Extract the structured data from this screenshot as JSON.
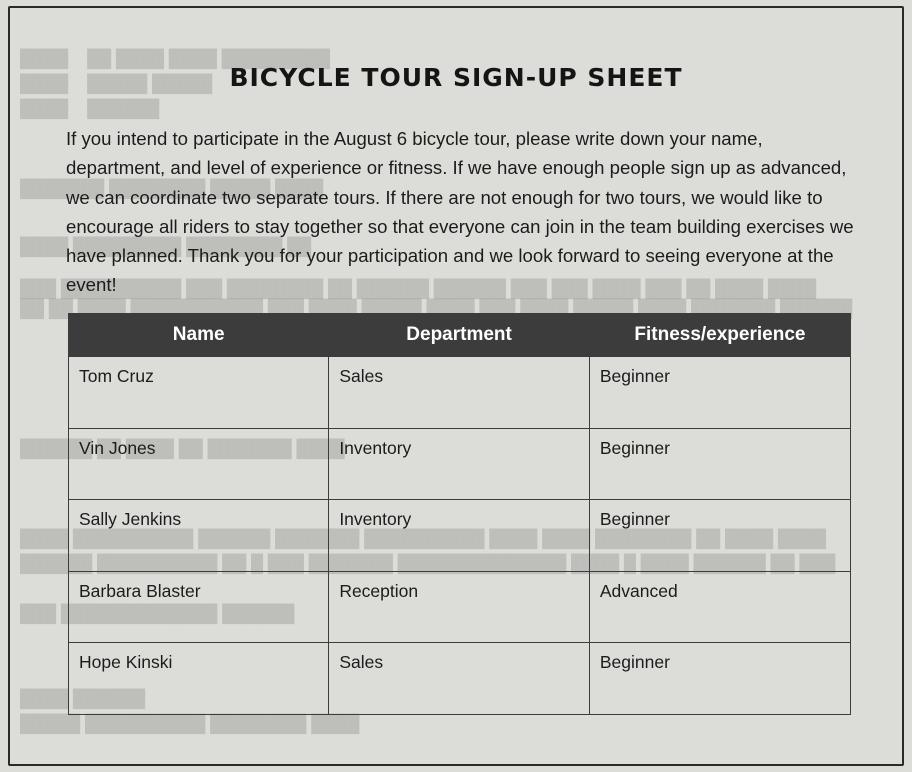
{
  "title": "BICYCLE TOUR SIGN-UP SHEET",
  "intro": "If you intend to participate in the August 6 bicycle tour, please write down your name, department, and level of experience or fitness. If we have enough people sign up as advanced, we can coordinate two separate tours. If there are not enough for two tours, we would like to encourage all riders to stay together so that everyone can join in the team building exercises we have planned. Thank you for your participation and we look forward to seeing everyone at the event!",
  "table": {
    "headers": [
      "Name",
      "Department",
      "Fitness/experience"
    ],
    "rows": [
      {
        "name": "Tom Cruz",
        "department": "Sales",
        "fitness": "Beginner"
      },
      {
        "name": "Vin Jones",
        "department": "Inventory",
        "fitness": "Beginner"
      },
      {
        "name": "Sally Jenkins",
        "department": "Inventory",
        "fitness": "Beginner"
      },
      {
        "name": "Barbara Blaster",
        "department": "Reception",
        "fitness": "Advanced"
      },
      {
        "name": "Hope Kinski",
        "department": "Sales",
        "fitness": "Beginner"
      }
    ]
  },
  "colors": {
    "header_bg": "#3c3c3c",
    "paper": "#dcdcd8"
  }
}
